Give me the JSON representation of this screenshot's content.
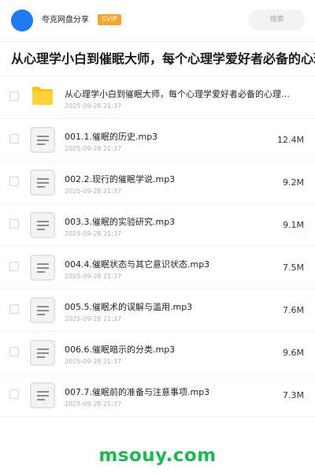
{
  "header": {
    "share_name": "夸克网盘分享",
    "badge": "SVIP",
    "search_placeholder": "搜索"
  },
  "title": "从心理学小白到催眠大师，每个心理学爱好者必备的心理技能",
  "files": [
    {
      "type": "folder",
      "name": "从心理学小白到催眠大师，每个心理学爱好者必备的心理…",
      "date": "2025-09-28 21:37",
      "size": ""
    },
    {
      "type": "audio",
      "name": "001.1.催眠的历史.mp3",
      "date": "2025-09-28 21:37",
      "size": "12.4M"
    },
    {
      "type": "audio",
      "name": "002.2.现行的催眠学说.mp3",
      "date": "2025-09-28 21:37",
      "size": "9.2M"
    },
    {
      "type": "audio",
      "name": "003.3.催眠的实验研究.mp3",
      "date": "2025-09-28 21:37",
      "size": "9.1M"
    },
    {
      "type": "audio",
      "name": "004.4.催眠状态与其它意识状态.mp3",
      "date": "2025-09-28 21:37",
      "size": "7.5M"
    },
    {
      "type": "audio",
      "name": "005.5.催眠术的误解与滥用.mp3",
      "date": "2025-09-28 21:37",
      "size": "7.6M"
    },
    {
      "type": "audio",
      "name": "006.6.催眠暗示的分类.mp3",
      "date": "2025-09-28 21:37",
      "size": "9.6M"
    },
    {
      "type": "audio",
      "name": "007.7.催眠前的准备与注意事项.mp3",
      "date": "2025-09-28 21:37",
      "size": "7.3M"
    }
  ],
  "watermark": "msouy.com",
  "colors": {
    "avatar": "#1e7bf5",
    "badge": "#f7a529",
    "folder": "#fcc419",
    "watermark": "#1db84f"
  }
}
